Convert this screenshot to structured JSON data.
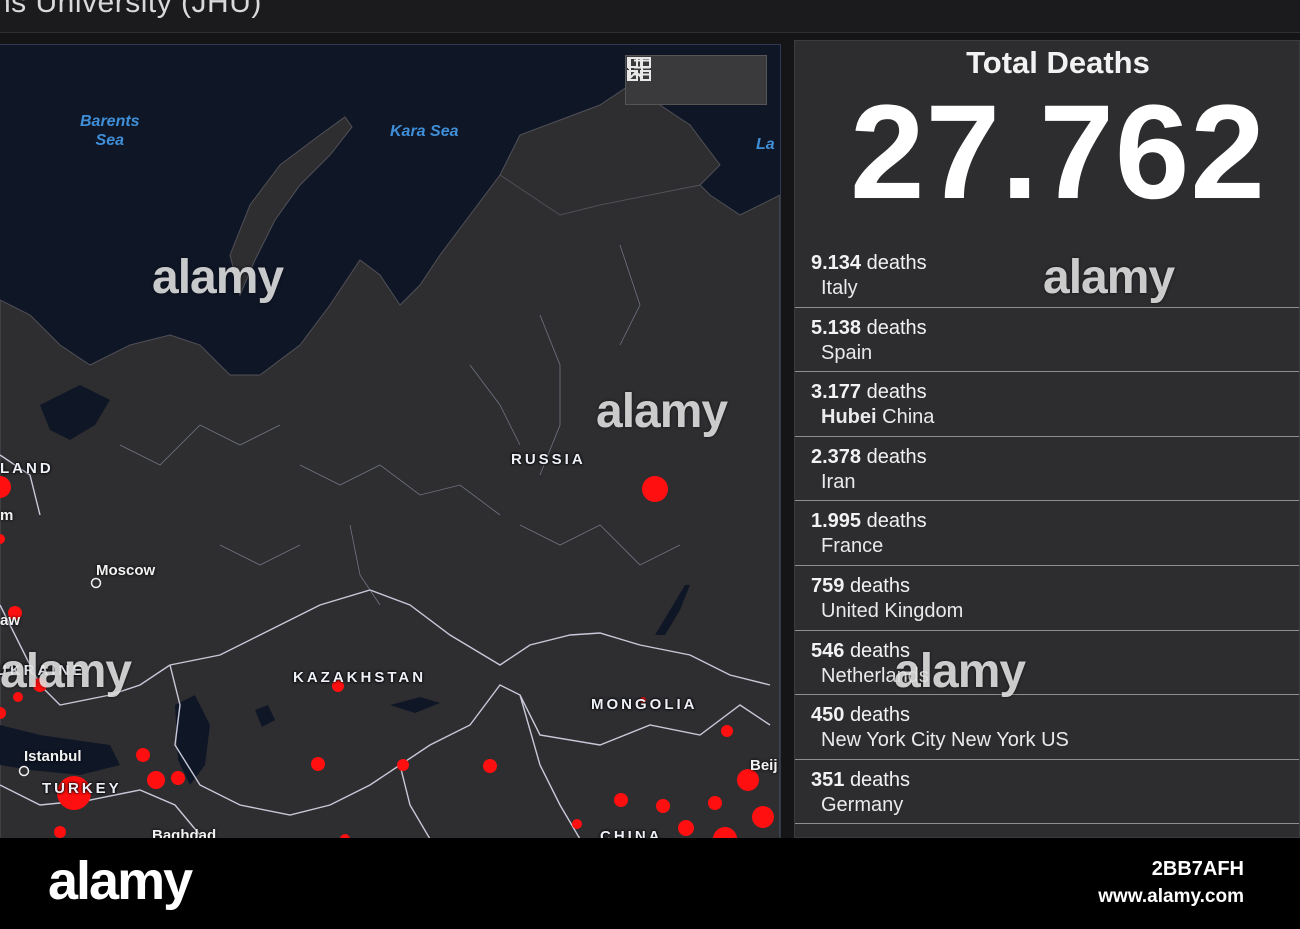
{
  "header": {
    "title": "ns University (JHU)"
  },
  "map": {
    "seas": {
      "barents": "Barents\nSea",
      "kara": "Kara Sea",
      "laptev": "La"
    },
    "countries": {
      "russia": "RUSSIA",
      "kazakhstan": "KAZAKHSTAN",
      "mongolia": "MONGOLIA",
      "ukraine": "UKRAINE",
      "turkey": "TURKEY",
      "china": "CHINA",
      "finland": "LAND"
    },
    "cities": {
      "moscow": "Moscow",
      "istanbul": "Istanbul",
      "baghdad": "Baghdad",
      "warsaw": "aw",
      "beijing": "Beij",
      "stockholm": "m"
    },
    "toolbar": [
      "bookmark-icon",
      "list-icon",
      "grid-icon"
    ],
    "colors": {
      "ocean": "#0f1626",
      "land": "#2e2e31",
      "border": "#c8c8d8",
      "case_dot": "#ff0f0f"
    }
  },
  "deaths": {
    "title": "Total Deaths",
    "total": "27.762",
    "unit": "deaths",
    "items": [
      {
        "count": "9.134",
        "region_bold": "",
        "place": "Italy"
      },
      {
        "count": "5.138",
        "region_bold": "",
        "place": "Spain"
      },
      {
        "count": "3.177",
        "region_bold": "Hubei",
        "place": "China"
      },
      {
        "count": "2.378",
        "region_bold": "",
        "place": "Iran"
      },
      {
        "count": "1.995",
        "region_bold": "",
        "place": "France"
      },
      {
        "count": "759",
        "region_bold": "",
        "place": "United Kingdom"
      },
      {
        "count": "546",
        "region_bold": "",
        "place": "Netherlands"
      },
      {
        "count": "450",
        "region_bold": "",
        "place": "New York City New York US"
      },
      {
        "count": "351",
        "region_bold": "",
        "place": "Germany"
      }
    ]
  },
  "watermark": {
    "brand": "alamy",
    "image_id": "2BB7AFH",
    "url": "www.alamy.com"
  }
}
